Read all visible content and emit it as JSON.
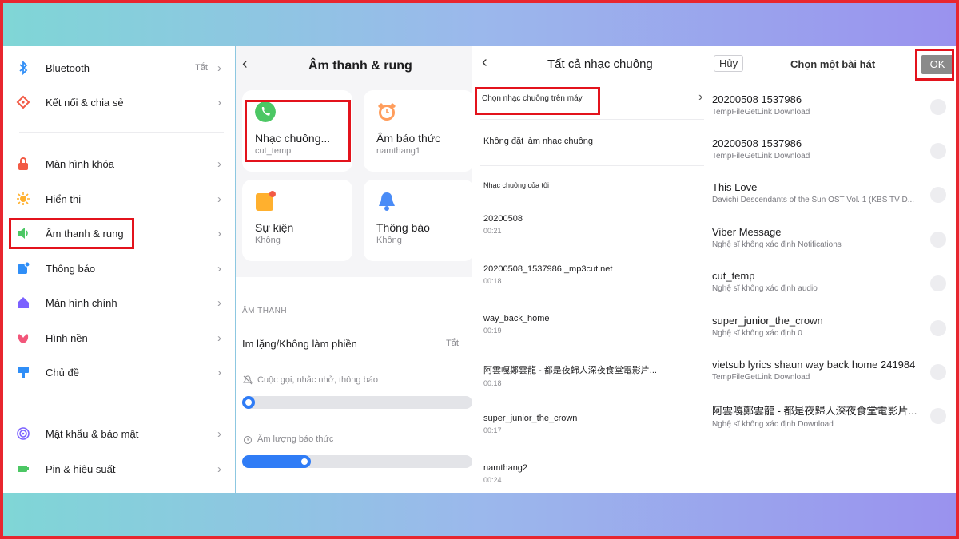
{
  "panel_settings": {
    "items": [
      {
        "label": "Bluetooth",
        "value": "Tắt",
        "icon": "bluetooth-icon"
      },
      {
        "label": "Kết nối & chia sẻ",
        "value": "",
        "icon": "connection-icon"
      },
      {
        "label": "Màn hình khóa",
        "value": "",
        "icon": "lock-icon"
      },
      {
        "label": "Hiển thị",
        "value": "",
        "icon": "brightness-icon"
      },
      {
        "label": "Âm thanh & rung",
        "value": "",
        "icon": "speaker-icon"
      },
      {
        "label": "Thông báo",
        "value": "",
        "icon": "notification-icon"
      },
      {
        "label": "Màn hình chính",
        "value": "",
        "icon": "home-icon"
      },
      {
        "label": "Hình nền",
        "value": "",
        "icon": "flower-icon"
      },
      {
        "label": "Chủ đề",
        "value": "",
        "icon": "brush-icon"
      },
      {
        "label": "Mật khẩu & bảo mật",
        "value": "",
        "icon": "fingerprint-icon"
      },
      {
        "label": "Pin & hiệu suất",
        "value": "",
        "icon": "battery-icon"
      }
    ],
    "chevron": "›"
  },
  "panel_sound": {
    "title": "Âm thanh & rung",
    "cards": [
      {
        "title": "Nhạc chuông...",
        "sub": "cut_temp",
        "icon": "phone-icon",
        "color": "#4cc764"
      },
      {
        "title": "Âm báo thức",
        "sub": "namthang1",
        "icon": "alarm-icon",
        "color": "#ff9d5c"
      },
      {
        "title": "Sự kiện",
        "sub": "Không",
        "icon": "calendar-icon",
        "color": "#ffb02e"
      },
      {
        "title": "Thông báo",
        "sub": "Không",
        "icon": "bell-icon",
        "color": "#4a8cf7"
      }
    ],
    "section": "ÂM THANH",
    "silent_label": "Im lặng/Không làm phiền",
    "silent_value": "Tắt",
    "ring_label": "Cuộc gọi, nhắc nhở, thông báo",
    "ring_level": 0.04,
    "alarm_label": "Âm lượng báo thức",
    "alarm_level": 0.3,
    "accent": "#2f7cf6"
  },
  "panel_ringtones": {
    "title": "Tất cả nhạc chuông",
    "pick_device": "Chọn nhạc chuông trên máy",
    "no_ringtone": "Không đặt làm nhạc chuông",
    "my_ringtones": "Nhạc chuông của tôi",
    "items": [
      {
        "name": "20200508",
        "dur": "00:21"
      },
      {
        "name": "20200508_1537986 _mp3cut.net",
        "dur": "00:18"
      },
      {
        "name": "way_back_home",
        "dur": "00:19"
      },
      {
        "name": "阿雲嘎鄭雲龍 - 都是夜歸人深夜食堂電影片...",
        "dur": "00:18"
      },
      {
        "name": "super_junior_the_crown",
        "dur": "00:17"
      },
      {
        "name": "namthang2",
        "dur": "00:24"
      }
    ]
  },
  "panel_songs": {
    "cancel": "Hủy",
    "title": "Chọn một bài hát",
    "ok": "OK",
    "items": [
      {
        "title": "20200508 1537986",
        "sub": "TempFileGetLink Download"
      },
      {
        "title": "20200508 1537986",
        "sub": "TempFileGetLink Download"
      },
      {
        "title": "This Love",
        "sub": "Davichi Descendants of the Sun OST Vol. 1 (KBS TV D..."
      },
      {
        "title": "Viber Message",
        "sub": "Nghệ sĩ không xác định Notifications"
      },
      {
        "title": "cut_temp",
        "sub": "Nghệ sĩ không xác định audio"
      },
      {
        "title": "super_junior_the_crown",
        "sub": "Nghệ sĩ không xác định 0"
      },
      {
        "title": "vietsub lyrics shaun way back home 241984",
        "sub": "TempFileGetLink Download"
      },
      {
        "title": "阿雲嘎鄭雲龍 - 都是夜歸人深夜食堂電影片...",
        "sub": "Nghệ sĩ không xác định Download"
      }
    ]
  }
}
